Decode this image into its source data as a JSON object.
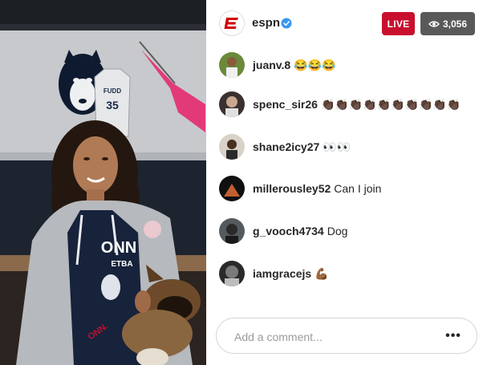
{
  "header": {
    "account_name": "espn",
    "verified_icon": "verified-badge-icon",
    "live_label": "LIVE",
    "viewer_count": "3,056",
    "viewer_icon": "eye-icon"
  },
  "comments": [
    {
      "user": "juanv.8",
      "message": "😂😂😂"
    },
    {
      "user": "spenc_sir26",
      "message": "👏🏿👏🏿👏🏿👏🏿👏🏿👏🏿👏🏿👏🏿👏🏿👏🏿"
    },
    {
      "user": "shane2icy27",
      "message": "👀👀"
    },
    {
      "user": "millerousley52",
      "message": "Can I join"
    },
    {
      "user": "g_vooch4734",
      "message": "Dog"
    },
    {
      "user": "iamgracejs",
      "message": "💪🏾"
    }
  ],
  "composer": {
    "placeholder": "Add a comment...",
    "more_icon": "more-options-icon",
    "more_label": "•••"
  },
  "video": {
    "jersey_name": "FUDD",
    "jersey_number": "35",
    "shirt_text": "ONN",
    "shirt_subtext": "ETBA",
    "shirt_bottom": "ONN."
  },
  "colors": {
    "live_red": "#c8102e",
    "viewer_gray": "#595959",
    "espn_red": "#d00000",
    "verified_blue": "#3897f0"
  }
}
